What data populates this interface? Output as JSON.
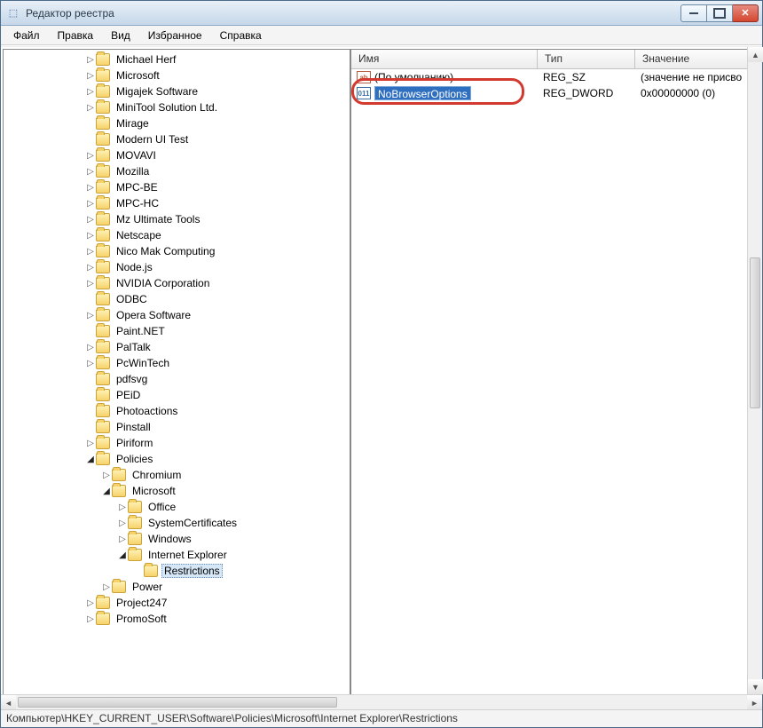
{
  "window": {
    "title": "Редактор реестра"
  },
  "menu": {
    "file": "Файл",
    "edit": "Правка",
    "view": "Вид",
    "favorites": "Избранное",
    "help": "Справка"
  },
  "tree": {
    "items": [
      {
        "label": "Michael Herf",
        "indent": 4,
        "expand": "closed"
      },
      {
        "label": "Microsoft",
        "indent": 4,
        "expand": "closed"
      },
      {
        "label": "Migajek Software",
        "indent": 4,
        "expand": "closed"
      },
      {
        "label": "MiniTool Solution Ltd.",
        "indent": 4,
        "expand": "closed"
      },
      {
        "label": "Mirage",
        "indent": 4,
        "expand": "leaf"
      },
      {
        "label": "Modern UI Test",
        "indent": 4,
        "expand": "leaf"
      },
      {
        "label": "MOVAVI",
        "indent": 4,
        "expand": "closed"
      },
      {
        "label": "Mozilla",
        "indent": 4,
        "expand": "closed"
      },
      {
        "label": "MPC-BE",
        "indent": 4,
        "expand": "closed"
      },
      {
        "label": "MPC-HC",
        "indent": 4,
        "expand": "closed"
      },
      {
        "label": "Mz Ultimate Tools",
        "indent": 4,
        "expand": "closed"
      },
      {
        "label": "Netscape",
        "indent": 4,
        "expand": "closed"
      },
      {
        "label": "Nico Mak Computing",
        "indent": 4,
        "expand": "closed"
      },
      {
        "label": "Node.js",
        "indent": 4,
        "expand": "closed"
      },
      {
        "label": "NVIDIA Corporation",
        "indent": 4,
        "expand": "closed"
      },
      {
        "label": "ODBC",
        "indent": 4,
        "expand": "leaf"
      },
      {
        "label": "Opera Software",
        "indent": 4,
        "expand": "closed"
      },
      {
        "label": "Paint.NET",
        "indent": 4,
        "expand": "leaf"
      },
      {
        "label": "PalTalk",
        "indent": 4,
        "expand": "closed"
      },
      {
        "label": "PcWinTech",
        "indent": 4,
        "expand": "closed"
      },
      {
        "label": "pdfsvg",
        "indent": 4,
        "expand": "leaf"
      },
      {
        "label": "PEiD",
        "indent": 4,
        "expand": "leaf"
      },
      {
        "label": "Photoactions",
        "indent": 4,
        "expand": "leaf"
      },
      {
        "label": "Pinstall",
        "indent": 4,
        "expand": "leaf"
      },
      {
        "label": "Piriform",
        "indent": 4,
        "expand": "closed"
      },
      {
        "label": "Policies",
        "indent": 4,
        "expand": "open"
      },
      {
        "label": "Chromium",
        "indent": 5,
        "expand": "closed"
      },
      {
        "label": "Microsoft",
        "indent": 5,
        "expand": "open"
      },
      {
        "label": "Office",
        "indent": 6,
        "expand": "closed"
      },
      {
        "label": "SystemCertificates",
        "indent": 6,
        "expand": "closed"
      },
      {
        "label": "Windows",
        "indent": 6,
        "expand": "closed"
      },
      {
        "label": "Internet Explorer",
        "indent": 6,
        "expand": "open"
      },
      {
        "label": "Restrictions",
        "indent": 7,
        "expand": "leaf",
        "selected": true
      },
      {
        "label": "Power",
        "indent": 5,
        "expand": "closed"
      },
      {
        "label": "Project247",
        "indent": 4,
        "expand": "closed"
      },
      {
        "label": "PromoSoft",
        "indent": 4,
        "expand": "closed"
      }
    ]
  },
  "columns": {
    "name": "Имя",
    "type": "Тип",
    "value": "Значение"
  },
  "values": [
    {
      "icon": "ab",
      "name": "(По умолчанию)",
      "type": "REG_SZ",
      "data": "(значение не присво"
    },
    {
      "icon": "bin",
      "name": "NoBrowserOptions",
      "type": "REG_DWORD",
      "data": "0x00000000 (0)",
      "editing": true
    }
  ],
  "statusbar": "Компьютер\\HKEY_CURRENT_USER\\Software\\Policies\\Microsoft\\Internet Explorer\\Restrictions"
}
